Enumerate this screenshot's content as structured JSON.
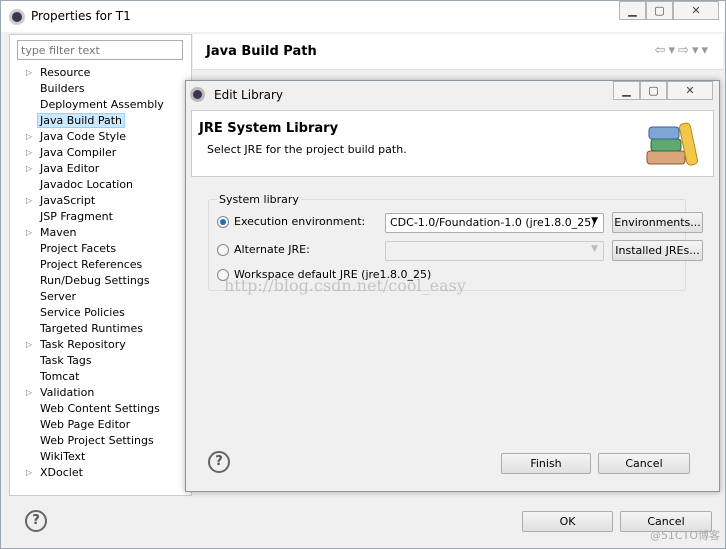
{
  "window": {
    "title": "Properties for T1",
    "controls": [
      "minimize",
      "maximize",
      "close"
    ]
  },
  "filter": {
    "placeholder": "type filter text"
  },
  "tree": [
    {
      "label": "Resource",
      "expandable": true
    },
    {
      "label": "Builders",
      "expandable": false
    },
    {
      "label": "Deployment Assembly",
      "expandable": false
    },
    {
      "label": "Java Build Path",
      "expandable": false,
      "selected": true
    },
    {
      "label": "Java Code Style",
      "expandable": true
    },
    {
      "label": "Java Compiler",
      "expandable": true
    },
    {
      "label": "Java Editor",
      "expandable": true
    },
    {
      "label": "Javadoc Location",
      "expandable": false
    },
    {
      "label": "JavaScript",
      "expandable": true
    },
    {
      "label": "JSP Fragment",
      "expandable": false
    },
    {
      "label": "Maven",
      "expandable": true
    },
    {
      "label": "Project Facets",
      "expandable": false
    },
    {
      "label": "Project References",
      "expandable": false
    },
    {
      "label": "Run/Debug Settings",
      "expandable": false
    },
    {
      "label": "Server",
      "expandable": false
    },
    {
      "label": "Service Policies",
      "expandable": false
    },
    {
      "label": "Targeted Runtimes",
      "expandable": false
    },
    {
      "label": "Task Repository",
      "expandable": true
    },
    {
      "label": "Task Tags",
      "expandable": false
    },
    {
      "label": "Tomcat",
      "expandable": false
    },
    {
      "label": "Validation",
      "expandable": true
    },
    {
      "label": "Web Content Settings",
      "expandable": false
    },
    {
      "label": "Web Page Editor",
      "expandable": false
    },
    {
      "label": "Web Project Settings",
      "expandable": false
    },
    {
      "label": "WikiText",
      "expandable": false
    },
    {
      "label": "XDoclet",
      "expandable": true
    }
  ],
  "right": {
    "title": "Java Build Path"
  },
  "dialog": {
    "title": "Edit Library",
    "heading": "JRE System Library",
    "description": "Select JRE for the project build path.",
    "group_label": "System library",
    "options": {
      "execution": {
        "label": "Execution environment:",
        "value": "CDC-1.0/Foundation-1.0 (jre1.8.0_25)",
        "selected": true,
        "button": "Environments..."
      },
      "alternate": {
        "label": "Alternate JRE:",
        "value": "",
        "selected": false,
        "button": "Installed JREs..."
      },
      "workspace": {
        "label": "Workspace default JRE (jre1.8.0_25)",
        "selected": false
      }
    },
    "finish": "Finish",
    "cancel": "Cancel"
  },
  "footer": {
    "ok": "OK",
    "cancel": "Cancel"
  },
  "watermark": {
    "url": "http://blog.csdn.net/cool_easy",
    "corner": "@51CTO博客"
  }
}
